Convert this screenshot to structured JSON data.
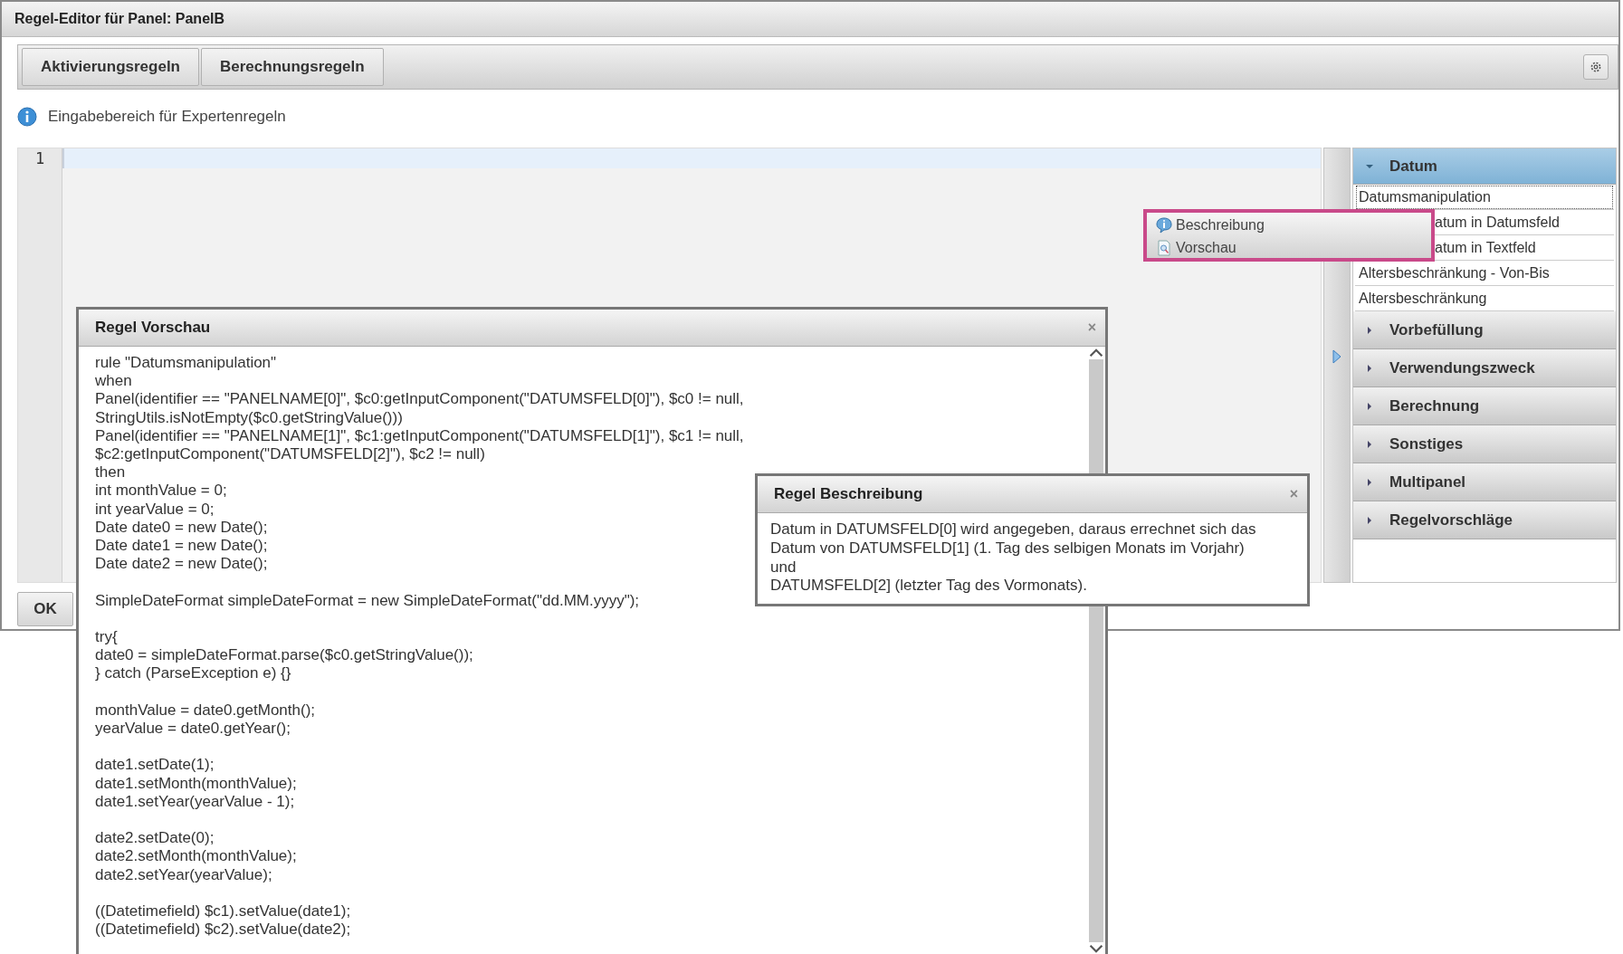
{
  "window": {
    "title": "Regel-Editor für Panel: PanelB"
  },
  "toolbar": {
    "buttons": [
      "Aktivierungsregeln",
      "Berechnungsregeln"
    ]
  },
  "info": {
    "text": "Eingabebereich für Expertenregeln"
  },
  "editor": {
    "line_numbers": [
      "1"
    ]
  },
  "rule_sections": [
    {
      "title": "Datum",
      "expanded": true,
      "selected": true,
      "items": [
        {
          "label": "Datumsmanipulation",
          "selected": true
        },
        {
          "label": "atum in Datumsfeld",
          "selected": false
        },
        {
          "label": "atum in Textfeld",
          "selected": false
        },
        {
          "label": "Altersbeschränkung - Von-Bis",
          "selected": false
        },
        {
          "label": "Altersbeschränkung",
          "selected": false
        }
      ]
    },
    {
      "title": "Vorbefüllung",
      "expanded": false,
      "selected": false
    },
    {
      "title": "Verwendungszweck",
      "expanded": false,
      "selected": false
    },
    {
      "title": "Berechnung",
      "expanded": false,
      "selected": false
    },
    {
      "title": "Sonstiges",
      "expanded": false,
      "selected": false
    },
    {
      "title": "Multipanel",
      "expanded": false,
      "selected": false
    },
    {
      "title": "Regelvorschläge",
      "expanded": false,
      "selected": false
    }
  ],
  "context_menu": {
    "items": [
      {
        "label": "Beschreibung",
        "kind": "description"
      },
      {
        "label": "Vorschau",
        "kind": "preview"
      }
    ]
  },
  "footer": {
    "buttons": [
      "OK"
    ]
  },
  "preview_dialog": {
    "title": "Regel Vorschau",
    "close": "×",
    "code_blocks": [
      [
        "rule \"Datumsmanipulation\"",
        "when",
        "Panel(identifier == \"PANELNAME[0]\", $c0:getInputComponent(\"DATUMSFELD[0]\"), $c0 != null,",
        "StringUtils.isNotEmpty($c0.getStringValue()))",
        "Panel(identifier == \"PANELNAME[1]\", $c1:getInputComponent(\"DATUMSFELD[1]\"), $c1 != null,",
        "$c2:getInputComponent(\"DATUMSFELD[2]\"), $c2 != null)",
        "then",
        "int monthValue = 0;",
        "int yearValue = 0;",
        "Date date0 = new Date();",
        "Date date1 = new Date();",
        "Date date2 = new Date();"
      ],
      [
        "SimpleDateFormat simpleDateFormat = new SimpleDateFormat(\"dd.MM.yyyy\");"
      ],
      [
        "try{",
        "date0 = simpleDateFormat.parse($c0.getStringValue());",
        "} catch (ParseException e) {}"
      ],
      [
        "monthValue = date0.getMonth();",
        "yearValue = date0.getYear();"
      ],
      [
        "date1.setDate(1);",
        "date1.setMonth(monthValue);",
        "date1.setYear(yearValue - 1);"
      ],
      [
        "date2.setDate(0);",
        "date2.setMonth(monthValue);",
        "date2.setYear(yearValue);"
      ],
      [
        "((Datetimefield) $c1).setValue(date1);",
        "((Datetimefield) $c2).setValue(date2);"
      ]
    ]
  },
  "description_dialog": {
    "title": "Regel Beschreibung",
    "close": "×",
    "text": "Datum in DATUMSFELD[0] wird angegeben, daraus errechnet sich das Datum von DATUMSFELD[1] (1. Tag des selbigen Monats im Vorjahr) und\nDATUMSFELD[2] (letzter Tag des Vormonats)."
  }
}
